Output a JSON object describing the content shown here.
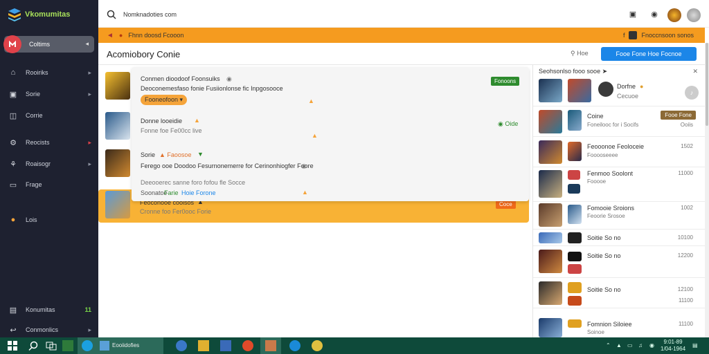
{
  "app": {
    "name": "Vkomumitas"
  },
  "search": {
    "text": "Nomknadoties com"
  },
  "banner": {
    "left_text": "Fhnn doosd Fcooon",
    "right_text": "Fnoccnsoon sonos"
  },
  "page": {
    "title": "Acomiobory Conie",
    "search_text": "Hoe",
    "button_label": "Fooe Fone Hoe Focnoe"
  },
  "sidebar": {
    "active": {
      "label": "Coltims"
    },
    "items": [
      {
        "label": "Rooiriks"
      },
      {
        "label": "Sorie"
      },
      {
        "label": "Corrie"
      },
      {
        "label": "Reocists"
      },
      {
        "label": "Roaisogr"
      },
      {
        "label": "Frage"
      },
      {
        "label": "Lois"
      }
    ],
    "bottom": [
      {
        "label": "Konumitas",
        "badge": "11"
      },
      {
        "label": "Conmonlics"
      }
    ]
  },
  "feed": [
    {
      "title": "Conmen dioodoof Foonsuiks",
      "sub": "Deoconemesfaso fonie Fusiionlonse fic Inpgosooce",
      "pill": "Fooneofoon",
      "tag": "Fonoons"
    },
    {
      "title": "Donne looeidie",
      "sub": "Fonne foe Fe00cc live",
      "tag": "Oide"
    },
    {
      "title": "Sorie",
      "title2": "Faoosoe",
      "sub": "Ferego ooe Doodoo Fesurnonemerre for Cerinonhiogfer Foore",
      "line2": "Deeooerec sanne foro fofou fle Socce",
      "line3_a": "Soonatoe",
      "line3_b": "Farie",
      "line3_c": "Hoie Forone"
    },
    {
      "title": "Feoconooe cooisos",
      "sub": "Cronne foo Fer0ooc Forie",
      "tag": "Coce"
    }
  ],
  "right_panel": {
    "header": "Seohsonlso fooo sooe",
    "items": [
      {
        "title": "Dorfne",
        "sub": "Cecuoe"
      },
      {
        "title": "Coine",
        "sub": "Foneilooc for i Socifs",
        "btn": "Fooe Fone",
        "time": "Ooiis"
      },
      {
        "title": "Feooonoe Feoloceie",
        "sub": "Fooooseeee",
        "time": "1502"
      },
      {
        "title": "Fenmoo Soolont",
        "sub": "Fooooe",
        "time": "11000"
      },
      {
        "title": "Fomooie Sroions",
        "sub": "Feoorie Srosoe",
        "time": "1002"
      },
      {
        "title": "Soitie So no",
        "time": "10100"
      },
      {
        "title": "Soitie So no",
        "time": "12200"
      },
      {
        "title": "Soitie So no",
        "time": "12100"
      },
      {
        "title": "Soitie So no",
        "time": "11100"
      },
      {
        "title": "Fomnion Siloiee",
        "sub": "Soinoe",
        "time": "11100"
      }
    ]
  },
  "taskbar": {
    "app_label": "Eooiidofies",
    "clock_time": "9:01-89",
    "clock_date": "1/04-1964"
  },
  "colors": {
    "sidebar": "#1e2130",
    "accent_orange": "#f59b1f",
    "accent_blue": "#1b86e8",
    "accent_green": "#2e8b2e",
    "taskbar": "#0e4a3a"
  }
}
